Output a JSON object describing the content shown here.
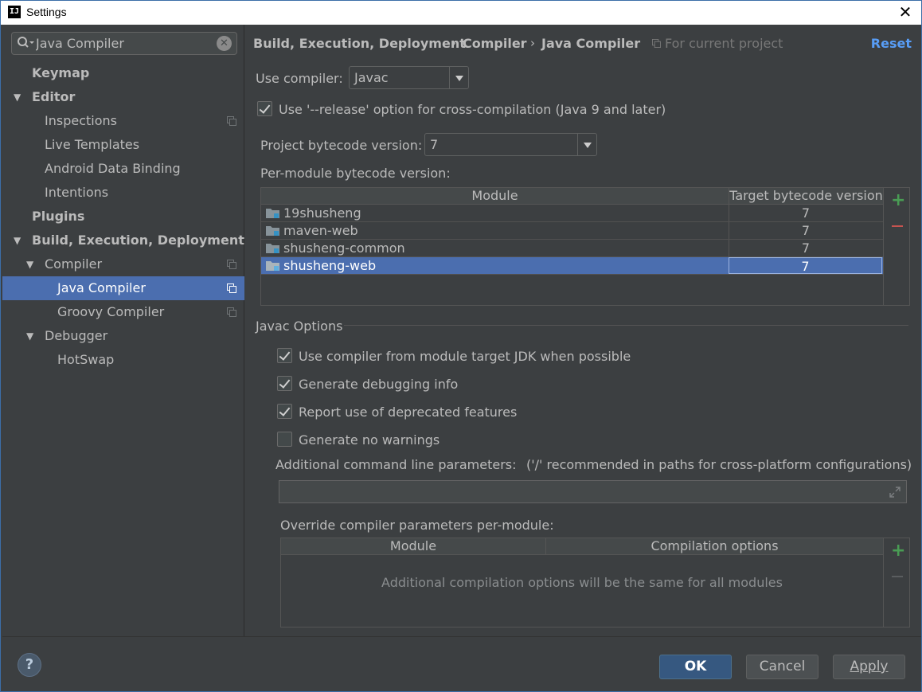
{
  "window": {
    "title": "Settings",
    "app_icon": "IJ"
  },
  "sidebar": {
    "search_value": "Java Compiler",
    "items": [
      {
        "label": "Keymap"
      },
      {
        "label": "Editor"
      },
      {
        "label": "Inspections"
      },
      {
        "label": "Live Templates"
      },
      {
        "label": "Android Data Binding"
      },
      {
        "label": "Intentions"
      },
      {
        "label": "Plugins"
      },
      {
        "label": "Build, Execution, Deployment"
      },
      {
        "label": "Compiler"
      },
      {
        "label": "Java Compiler"
      },
      {
        "label": "Groovy Compiler"
      },
      {
        "label": "Debugger"
      },
      {
        "label": "HotSwap"
      }
    ]
  },
  "header": {
    "breadcrumb": [
      "Build, Execution, Deployment",
      "Compiler",
      "Java Compiler"
    ],
    "separator": "›",
    "scope": "For current project",
    "reset": "Reset"
  },
  "compiler": {
    "use_label": "Use compiler:",
    "use_value": "Javac",
    "release_label": "Use '--release' option for cross-compilation (Java 9 and later)",
    "release_checked": true,
    "project_bytecode_label": "Project bytecode version:",
    "project_bytecode_value": "7",
    "per_module_label": "Per-module bytecode version:",
    "table_headers": [
      "Module",
      "Target bytecode version"
    ],
    "modules": [
      {
        "name": "19shusheng",
        "version": "7",
        "selected": false
      },
      {
        "name": "maven-web",
        "version": "7",
        "selected": false
      },
      {
        "name": "shusheng-common",
        "version": "7",
        "selected": false
      },
      {
        "name": "shusheng-web",
        "version": "7",
        "selected": true
      }
    ]
  },
  "javac": {
    "section_title": "Javac Options",
    "options": [
      {
        "label": "Use compiler from module target JDK when possible",
        "checked": true
      },
      {
        "label": "Generate debugging info",
        "checked": true
      },
      {
        "label": "Report use of deprecated features",
        "checked": true
      },
      {
        "label": "Generate no warnings",
        "checked": false
      }
    ],
    "additional_params_label": "Additional command line parameters:",
    "additional_params_hint": "('/' recommended in paths for cross-platform configurations)",
    "additional_params_value": "",
    "override_label": "Override compiler parameters per-module:",
    "override_headers": [
      "Module",
      "Compilation options"
    ],
    "override_empty": "Additional compilation options will be the same for all modules"
  },
  "footer": {
    "help": "?",
    "ok": "OK",
    "cancel": "Cancel",
    "apply": "Apply"
  },
  "colors": {
    "background": "#3c3f41",
    "selection": "#4b6eaf",
    "link": "#589df6",
    "add": "#499c54",
    "remove": "#c75450"
  }
}
